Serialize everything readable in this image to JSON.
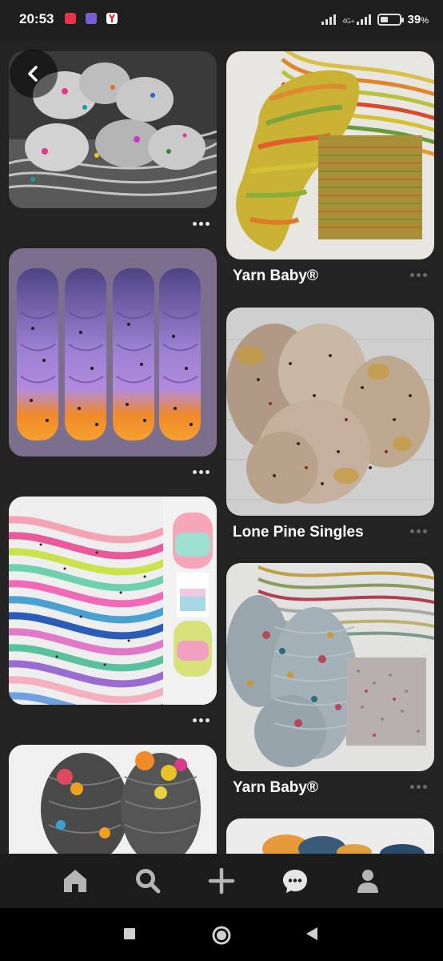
{
  "status_bar": {
    "time": "20:53",
    "network": "4G+",
    "battery_percent": "39",
    "battery_unit": "%",
    "app_icons": [
      "notification-app-icon",
      "viber-icon",
      "yandex-icon"
    ]
  },
  "feed": {
    "left_column": [
      {
        "name": "yarn-pin-1",
        "description": "grey speckled yarn skeins"
      },
      {
        "name": "yarn-pin-3",
        "description": "purple to orange gradient skeins"
      },
      {
        "name": "yarn-pin-5",
        "description": "rainbow speckled yarn"
      },
      {
        "name": "yarn-pin-7",
        "description": "grey yarn with rainbow dye"
      }
    ],
    "right_column": [
      {
        "name": "yarn-pin-2",
        "title": "Yarn Baby®"
      },
      {
        "name": "yarn-pin-4",
        "title": "Lone Pine Singles"
      },
      {
        "name": "yarn-pin-6",
        "title": "Yarn Baby®"
      },
      {
        "name": "yarn-pin-8",
        "title": ""
      }
    ]
  },
  "bottom_nav": [
    "home-icon",
    "search-icon",
    "create-icon",
    "messages-icon",
    "profile-icon"
  ],
  "colors": {
    "background": "#232323",
    "nav_background": "#1c1c1c",
    "text": "#ffffff"
  }
}
